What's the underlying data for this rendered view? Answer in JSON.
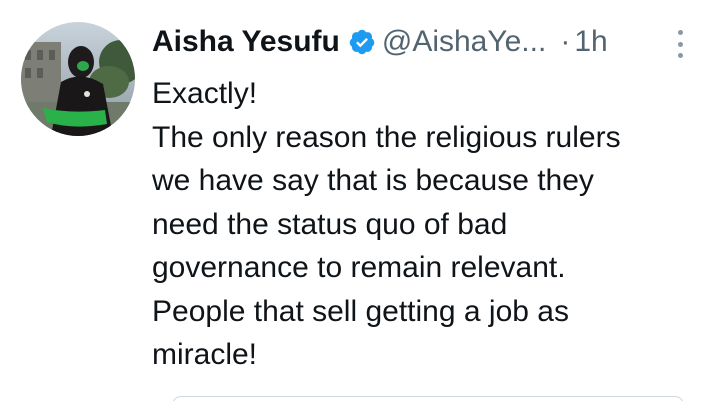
{
  "tweet": {
    "author_name": "Aisha Yesufu",
    "handle": "@AishaYe...",
    "separator": "·",
    "time": "1h",
    "body_lines": [
      "Exactly!",
      "The only reason the religious rulers",
      "we have say that is because they",
      "need the status quo of bad",
      "governance to remain relevant.",
      "People that sell getting a job as",
      "miracle!"
    ]
  },
  "icons": {
    "verified": "verified-badge-icon",
    "more": "more-options-icon"
  },
  "colors": {
    "text_primary": "#0f1419",
    "text_secondary": "#536471",
    "verified_blue": "#1d9bf0"
  }
}
